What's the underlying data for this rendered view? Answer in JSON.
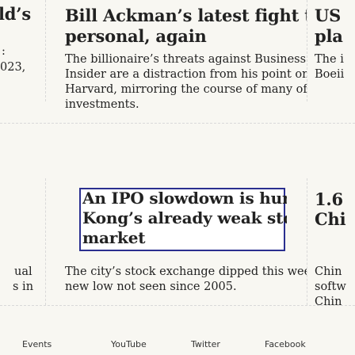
{
  "left_col": {
    "line1": "ld’s",
    "line2": ":",
    "line3": "023,",
    "line4": "ual",
    "line5": "s in"
  },
  "story1": {
    "headline_l1": "Bill Ackman’s latest fight turns",
    "headline_l2": "personal, again",
    "deck_l1": "The billionaire’s threats against Business",
    "deck_l2": "Insider are a distraction from his point on",
    "deck_l3": "Harvard, mirroring the course of many of his",
    "deck_l4": "investments."
  },
  "story2": {
    "headline_l1": "An IPO slowdown is hurting Hong",
    "headline_l2": "Kong’s already weak stock",
    "headline_l3": "market",
    "deck_l1": "The city’s stock exchange dipped this week to a",
    "deck_l2": "new low not seen since 2005."
  },
  "right_col": {
    "h1": "US",
    "h2": "pla",
    "d1": "The i",
    "d2": "Boeii",
    "h3": "1.6",
    "h4": "Chi",
    "d3": "Chin",
    "d4": "softw",
    "d5": "Chin"
  },
  "footer": {
    "links": [
      "Events",
      "YouTube",
      "Twitter",
      "Facebook"
    ]
  },
  "colors": {
    "highlight_border": "#2a2f8f",
    "background": "#f8f7f2"
  }
}
